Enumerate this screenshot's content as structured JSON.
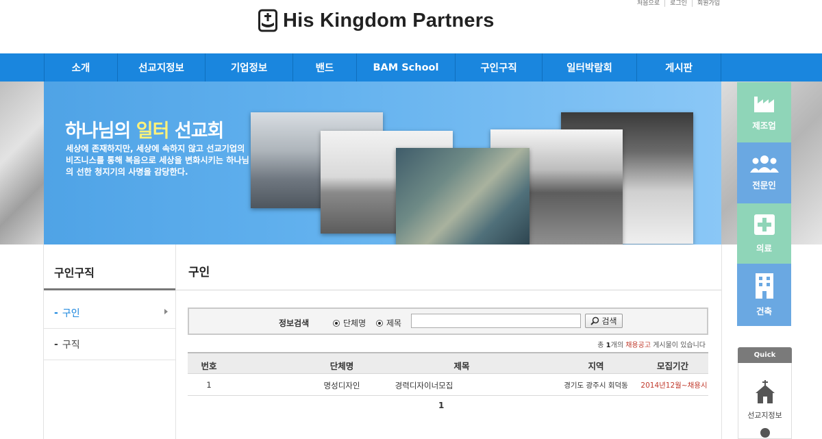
{
  "util_links": [
    "처음으로",
    "로그인",
    "회원가입"
  ],
  "brand": {
    "name": "His Kingdom Partners"
  },
  "nav": [
    "소개",
    "선교지정보",
    "기업정보",
    "밴드",
    "BAM School",
    "구인구직",
    "일터박람회",
    "게시판"
  ],
  "banner": {
    "title_main": "하나님의 ",
    "title_highlight": "일터",
    "title_tail": " 선교회",
    "subtitle": "세상에 존재하지만, 세상에 속하지 않고 선교기업의 비즈니스를 통해 복음으로 세상을 변화시키는 하나님의 선한 청지기의 사명을 감당한다."
  },
  "side_categories": [
    {
      "label": "제조업",
      "icon": "factory-icon",
      "color": "#8fd5b8"
    },
    {
      "label": "전문인",
      "icon": "people-icon",
      "color": "#6aa8e2"
    },
    {
      "label": "의료",
      "icon": "medical-cross-icon",
      "color": "#8fd5b8"
    },
    {
      "label": "건축",
      "icon": "building-icon",
      "color": "#6aa8e2"
    }
  ],
  "quick": {
    "title": "Quick",
    "item_label": "선교지정보",
    "item_icon": "church-icon"
  },
  "lnb": {
    "title": "구인구직",
    "items": [
      "구인",
      "구직"
    ]
  },
  "content": {
    "title": "구인",
    "search": {
      "label": "정보검색",
      "options": [
        "단체명",
        "제목"
      ],
      "placeholder": "",
      "button": "검색"
    },
    "count": {
      "prefix": "총 ",
      "number": "1",
      "unit": "개의 ",
      "highlight": "채용공고",
      "suffix": " 게시물이 있습니다"
    },
    "table": {
      "headers": [
        "번호",
        "단체명",
        "제목",
        "지역",
        "모집기간"
      ],
      "rows": [
        {
          "no": "1",
          "org": "명성디자인",
          "title": "경력디자이너모집",
          "region": "경기도 광주시 회덕동",
          "period": "2014년12월~채용시"
        }
      ]
    },
    "pagination": [
      "1"
    ]
  },
  "colors": {
    "nav": "#1a86de",
    "accent": "#1a86de",
    "highlight": "#c0392b"
  }
}
